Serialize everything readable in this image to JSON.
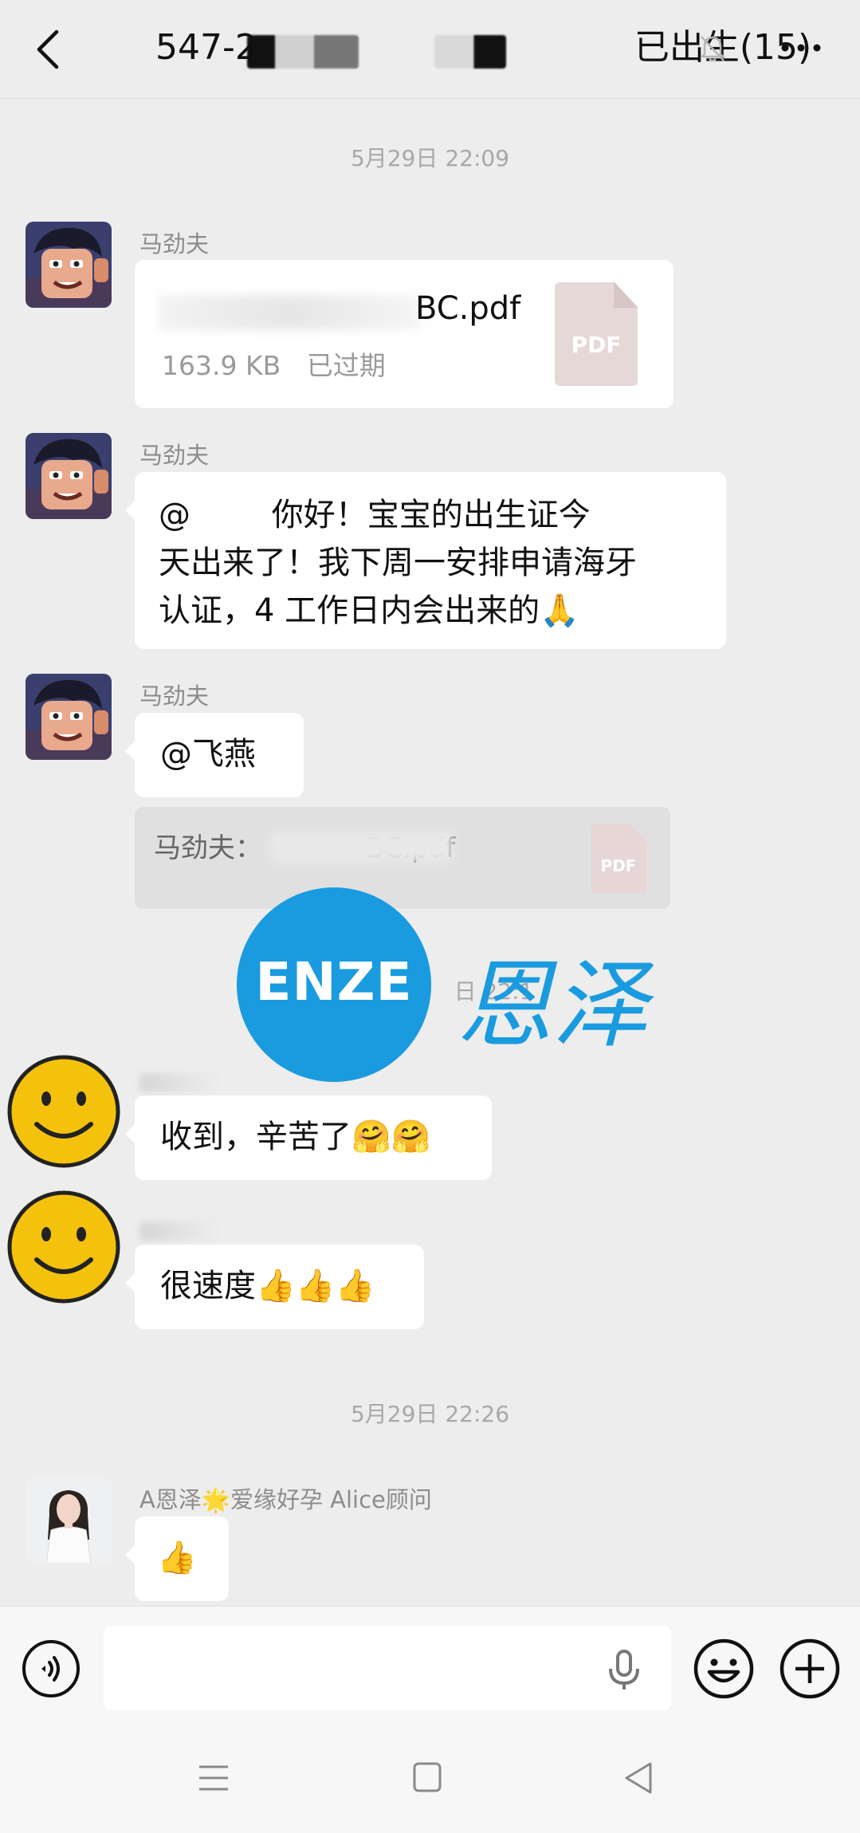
{
  "header": {
    "title_prefix": "547-2",
    "title_suffix": "已出生(15)"
  },
  "messages": [
    {
      "type": "time",
      "text": "5月29日 22:09"
    },
    {
      "sender": "马劲夫",
      "file": {
        "name": "BC.pdf",
        "size": "163.9 KB",
        "status": "已过期",
        "icon_label": "PDF"
      }
    },
    {
      "sender": "马劲夫",
      "text_lines": [
        "@        你好！宝宝的出生证今",
        "天出来了！我下周一安排申请海牙",
        "认证，4 工作日内会出来的🙏"
      ]
    },
    {
      "sender": "马劲夫",
      "text": "@飞燕",
      "quote": {
        "text": "马劲夫：            BC.pdf",
        "icon_label": "PDF"
      }
    },
    {
      "type": "time_hidden",
      "text": "日 22:1"
    },
    {
      "sender": "",
      "text": "收到，辛苦了🤗🤗"
    },
    {
      "sender": "",
      "text": "很速度👍👍👍"
    },
    {
      "type": "time",
      "text": "5月29日 22:26"
    },
    {
      "sender": "A恩泽🌟爱缘好孕 Alice顾问",
      "text": "👍"
    }
  ],
  "watermark": {
    "logo_text": "ENZE",
    "cn_text": "恩泽"
  },
  "colors": {
    "background": "#ededed",
    "bubble": "#ffffff",
    "watermark_blue": "#1a9be0",
    "meta_text": "#9a9a9a"
  },
  "icons": [
    "back-icon",
    "mute-bell-icon",
    "more-icon",
    "pdf-file-icon",
    "voice-toggle-icon",
    "microphone-icon",
    "emoji-icon",
    "plus-icon",
    "nav-menu-icon",
    "nav-home-icon",
    "nav-back-icon"
  ]
}
